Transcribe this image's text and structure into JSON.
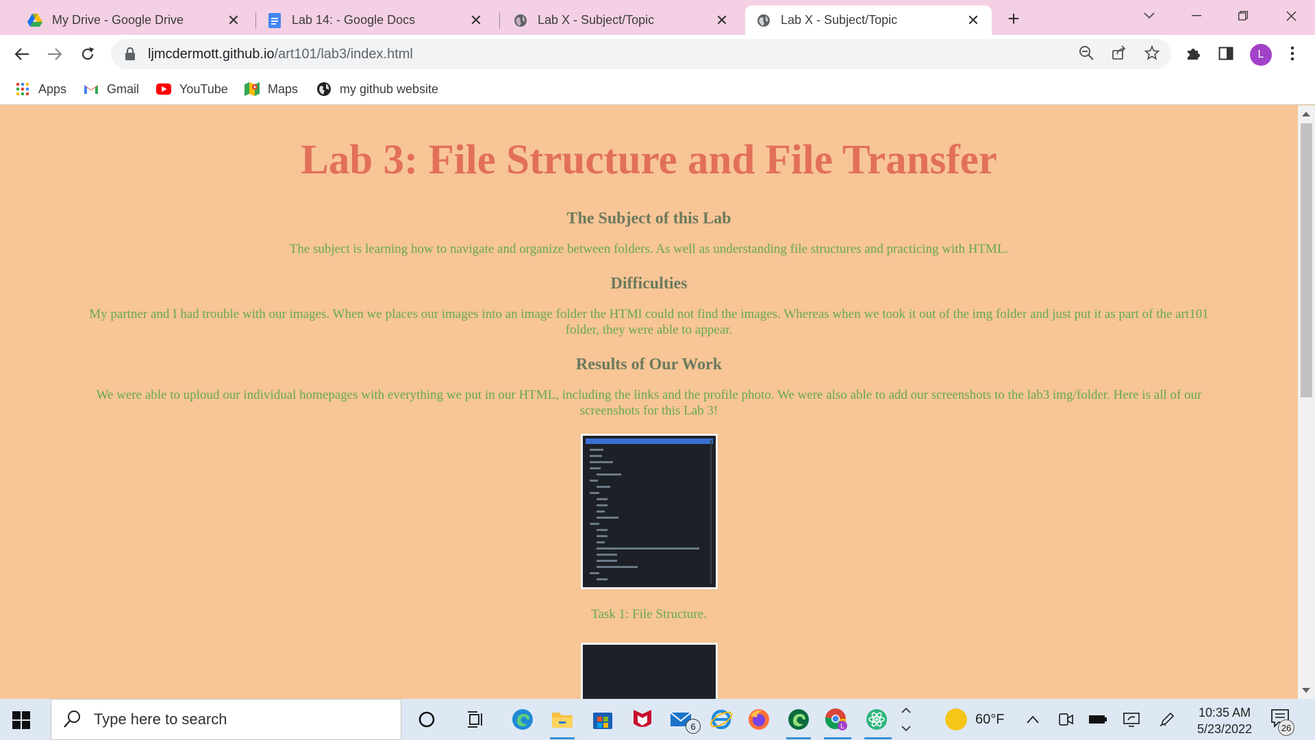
{
  "tabs": [
    {
      "title": "My Drive - Google Drive",
      "icon": "google-drive-icon"
    },
    {
      "title": "Lab 14: - Google Docs",
      "icon": "google-docs-icon"
    },
    {
      "title": "Lab X - Subject/Topic",
      "icon": "globe-icon"
    },
    {
      "title": "Lab X - Subject/Topic",
      "icon": "globe-icon",
      "active": true
    }
  ],
  "address": {
    "domain": "ljmcdermott.github.io",
    "path": "/art101/lab3/index.html"
  },
  "profile_initial": "L",
  "bookmarks": [
    {
      "label": "Apps",
      "icon": "apps-grid-icon"
    },
    {
      "label": "Gmail",
      "icon": "gmail-icon"
    },
    {
      "label": "YouTube",
      "icon": "youtube-icon"
    },
    {
      "label": "Maps",
      "icon": "maps-icon"
    },
    {
      "label": "my github website",
      "icon": "github-icon"
    }
  ],
  "page": {
    "title": "Lab 3: File Structure and File Transfer",
    "sections": [
      {
        "heading": "The Subject of this Lab",
        "text": "The subject is learning how to navigate and organize between folders. As well as understanding file structures and practicing with HTML."
      },
      {
        "heading": "Difficulties",
        "text": "My partner and I had trouble with our images. When we places our images into an image folder the HTMl could not find the images. Whereas when we took it out of the img folder and just put it as part of the art101 folder, they were able to appear."
      },
      {
        "heading": "Results of Our Work",
        "text": "We were able to uploud our individual homepages with everything we put in our HTML, including the links and the profile photo. We were also able to add our screenshots to the lab3 img/folder. Here is all of our screenshots for this Lab 3!"
      }
    ],
    "screenshot_caption_1": "Task 1: File Structure."
  },
  "taskbar": {
    "search_placeholder": "Type here to search",
    "mail_badge": "6",
    "weather": "60°F",
    "time": "10:35 AM",
    "date": "5/23/2022",
    "notification_count": "26"
  },
  "colors": {
    "page_background": "#f7c596",
    "title": "#e27058",
    "heading": "#6b7a5d",
    "body_text": "#67a84f",
    "tab_strip": "#f4d0e4"
  }
}
